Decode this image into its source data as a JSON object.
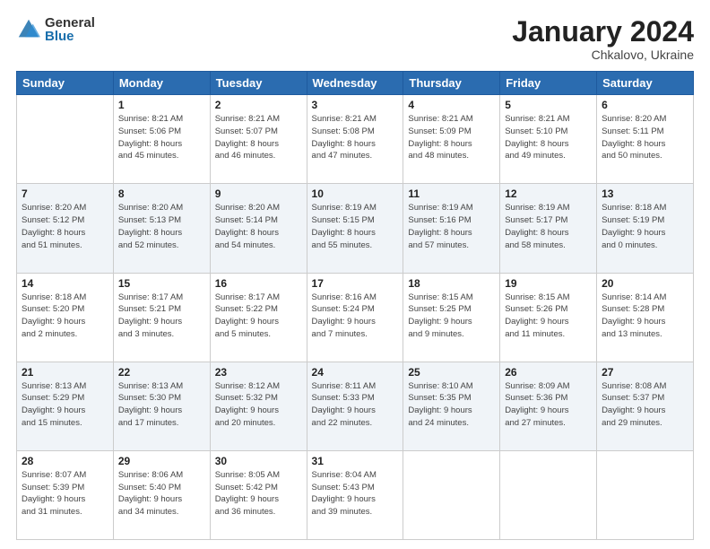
{
  "logo": {
    "general": "General",
    "blue": "Blue"
  },
  "header": {
    "month_year": "January 2024",
    "location": "Chkalovo, Ukraine"
  },
  "days_of_week": [
    "Sunday",
    "Monday",
    "Tuesday",
    "Wednesday",
    "Thursday",
    "Friday",
    "Saturday"
  ],
  "weeks": [
    [
      {
        "day": "",
        "info": ""
      },
      {
        "day": "1",
        "info": "Sunrise: 8:21 AM\nSunset: 5:06 PM\nDaylight: 8 hours\nand 45 minutes."
      },
      {
        "day": "2",
        "info": "Sunrise: 8:21 AM\nSunset: 5:07 PM\nDaylight: 8 hours\nand 46 minutes."
      },
      {
        "day": "3",
        "info": "Sunrise: 8:21 AM\nSunset: 5:08 PM\nDaylight: 8 hours\nand 47 minutes."
      },
      {
        "day": "4",
        "info": "Sunrise: 8:21 AM\nSunset: 5:09 PM\nDaylight: 8 hours\nand 48 minutes."
      },
      {
        "day": "5",
        "info": "Sunrise: 8:21 AM\nSunset: 5:10 PM\nDaylight: 8 hours\nand 49 minutes."
      },
      {
        "day": "6",
        "info": "Sunrise: 8:20 AM\nSunset: 5:11 PM\nDaylight: 8 hours\nand 50 minutes."
      }
    ],
    [
      {
        "day": "7",
        "info": "Sunrise: 8:20 AM\nSunset: 5:12 PM\nDaylight: 8 hours\nand 51 minutes."
      },
      {
        "day": "8",
        "info": "Sunrise: 8:20 AM\nSunset: 5:13 PM\nDaylight: 8 hours\nand 52 minutes."
      },
      {
        "day": "9",
        "info": "Sunrise: 8:20 AM\nSunset: 5:14 PM\nDaylight: 8 hours\nand 54 minutes."
      },
      {
        "day": "10",
        "info": "Sunrise: 8:19 AM\nSunset: 5:15 PM\nDaylight: 8 hours\nand 55 minutes."
      },
      {
        "day": "11",
        "info": "Sunrise: 8:19 AM\nSunset: 5:16 PM\nDaylight: 8 hours\nand 57 minutes."
      },
      {
        "day": "12",
        "info": "Sunrise: 8:19 AM\nSunset: 5:17 PM\nDaylight: 8 hours\nand 58 minutes."
      },
      {
        "day": "13",
        "info": "Sunrise: 8:18 AM\nSunset: 5:19 PM\nDaylight: 9 hours\nand 0 minutes."
      }
    ],
    [
      {
        "day": "14",
        "info": "Sunrise: 8:18 AM\nSunset: 5:20 PM\nDaylight: 9 hours\nand 2 minutes."
      },
      {
        "day": "15",
        "info": "Sunrise: 8:17 AM\nSunset: 5:21 PM\nDaylight: 9 hours\nand 3 minutes."
      },
      {
        "day": "16",
        "info": "Sunrise: 8:17 AM\nSunset: 5:22 PM\nDaylight: 9 hours\nand 5 minutes."
      },
      {
        "day": "17",
        "info": "Sunrise: 8:16 AM\nSunset: 5:24 PM\nDaylight: 9 hours\nand 7 minutes."
      },
      {
        "day": "18",
        "info": "Sunrise: 8:15 AM\nSunset: 5:25 PM\nDaylight: 9 hours\nand 9 minutes."
      },
      {
        "day": "19",
        "info": "Sunrise: 8:15 AM\nSunset: 5:26 PM\nDaylight: 9 hours\nand 11 minutes."
      },
      {
        "day": "20",
        "info": "Sunrise: 8:14 AM\nSunset: 5:28 PM\nDaylight: 9 hours\nand 13 minutes."
      }
    ],
    [
      {
        "day": "21",
        "info": "Sunrise: 8:13 AM\nSunset: 5:29 PM\nDaylight: 9 hours\nand 15 minutes."
      },
      {
        "day": "22",
        "info": "Sunrise: 8:13 AM\nSunset: 5:30 PM\nDaylight: 9 hours\nand 17 minutes."
      },
      {
        "day": "23",
        "info": "Sunrise: 8:12 AM\nSunset: 5:32 PM\nDaylight: 9 hours\nand 20 minutes."
      },
      {
        "day": "24",
        "info": "Sunrise: 8:11 AM\nSunset: 5:33 PM\nDaylight: 9 hours\nand 22 minutes."
      },
      {
        "day": "25",
        "info": "Sunrise: 8:10 AM\nSunset: 5:35 PM\nDaylight: 9 hours\nand 24 minutes."
      },
      {
        "day": "26",
        "info": "Sunrise: 8:09 AM\nSunset: 5:36 PM\nDaylight: 9 hours\nand 27 minutes."
      },
      {
        "day": "27",
        "info": "Sunrise: 8:08 AM\nSunset: 5:37 PM\nDaylight: 9 hours\nand 29 minutes."
      }
    ],
    [
      {
        "day": "28",
        "info": "Sunrise: 8:07 AM\nSunset: 5:39 PM\nDaylight: 9 hours\nand 31 minutes."
      },
      {
        "day": "29",
        "info": "Sunrise: 8:06 AM\nSunset: 5:40 PM\nDaylight: 9 hours\nand 34 minutes."
      },
      {
        "day": "30",
        "info": "Sunrise: 8:05 AM\nSunset: 5:42 PM\nDaylight: 9 hours\nand 36 minutes."
      },
      {
        "day": "31",
        "info": "Sunrise: 8:04 AM\nSunset: 5:43 PM\nDaylight: 9 hours\nand 39 minutes."
      },
      {
        "day": "",
        "info": ""
      },
      {
        "day": "",
        "info": ""
      },
      {
        "day": "",
        "info": ""
      }
    ]
  ]
}
